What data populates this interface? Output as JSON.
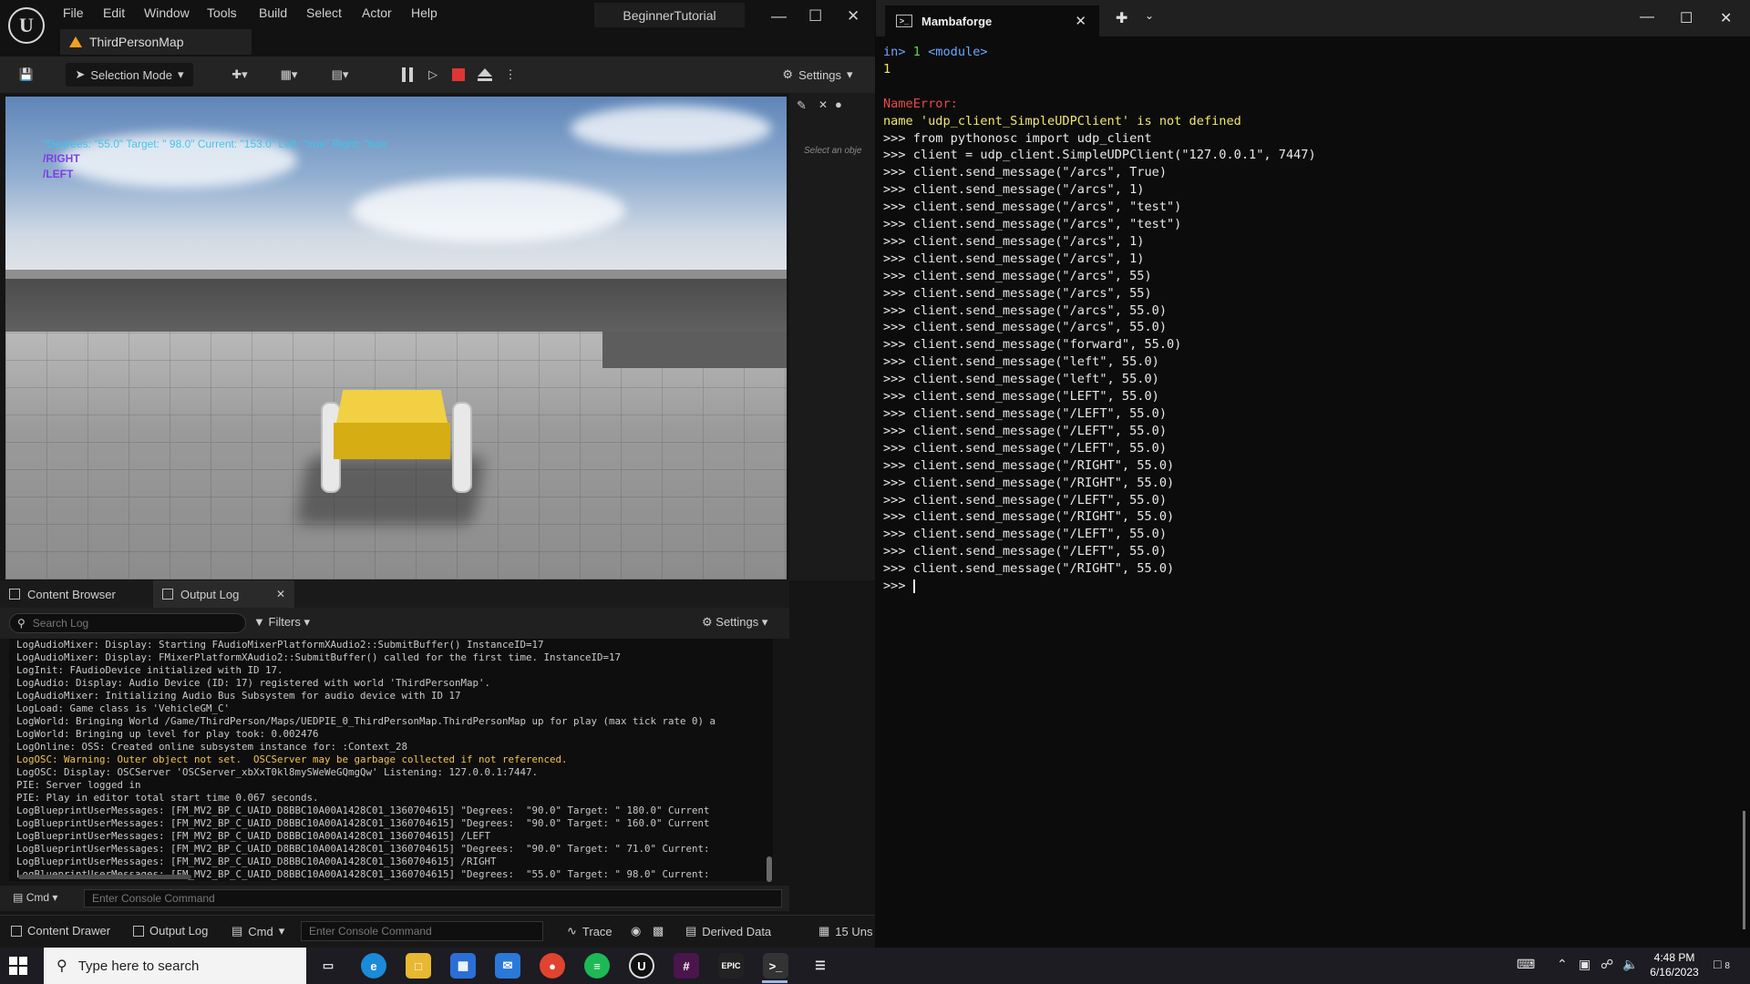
{
  "ue": {
    "menu": [
      "File",
      "Edit",
      "Window",
      "Tools",
      "Build",
      "Select",
      "Actor",
      "Help"
    ],
    "project_name": "BeginnerTutorial",
    "map_tab": "ThirdPersonMap",
    "toolbar": {
      "selection_mode": "Selection Mode",
      "settings": "Settings"
    },
    "viewport": {
      "debug_line": "\"Degrees: \"55.0\" Target: \" 98.0\" Current: \"153.0\" Left: \"true\" Right: \"true",
      "debug_right": "/RIGHT",
      "debug_left": "/LEFT"
    },
    "details": {
      "hint": "Select an obje"
    },
    "bottom_tabs": {
      "content_browser": "Content Browser",
      "output_log": "Output Log"
    },
    "log": {
      "search_placeholder": "Search Log",
      "filters": "Filters",
      "settings": "Settings",
      "lines": [
        {
          "text": "LogAudioMixer: Display: Starting FAudioMixerPlatformXAudio2::SubmitBuffer() InstanceID=17",
          "level": "normal"
        },
        {
          "text": "LogAudioMixer: Display: FMixerPlatformXAudio2::SubmitBuffer() called for the first time. InstanceID=17",
          "level": "normal"
        },
        {
          "text": "LogInit: FAudioDevice initialized with ID 17.",
          "level": "normal"
        },
        {
          "text": "LogAudio: Display: Audio Device (ID: 17) registered with world 'ThirdPersonMap'.",
          "level": "normal"
        },
        {
          "text": "LogAudioMixer: Initializing Audio Bus Subsystem for audio device with ID 17",
          "level": "normal"
        },
        {
          "text": "LogLoad: Game class is 'VehicleGM_C'",
          "level": "normal"
        },
        {
          "text": "LogWorld: Bringing World /Game/ThirdPerson/Maps/UEDPIE_0_ThirdPersonMap.ThirdPersonMap up for play (max tick rate 0) a",
          "level": "normal"
        },
        {
          "text": "LogWorld: Bringing up level for play took: 0.002476",
          "level": "normal"
        },
        {
          "text": "LogOnline: OSS: Created online subsystem instance for: :Context_28",
          "level": "normal"
        },
        {
          "text": "LogOSC: Warning: Outer object not set.  OSCServer may be garbage collected if not referenced.",
          "level": "warn"
        },
        {
          "text": "LogOSC: Display: OSCServer 'OSCServer_xbXxT0kl8mySWeWeGQmgQw' Listening: 127.0.0.1:7447.",
          "level": "normal"
        },
        {
          "text": "PIE: Server logged in",
          "level": "normal"
        },
        {
          "text": "PIE: Play in editor total start time 0.067 seconds.",
          "level": "normal"
        },
        {
          "text": "LogBlueprintUserMessages: [FM_MV2_BP_C_UAID_D8BBC10A00A1428C01_1360704615] \"Degrees:  \"90.0\" Target: \" 180.0\" Current",
          "level": "normal"
        },
        {
          "text": "LogBlueprintUserMessages: [FM_MV2_BP_C_UAID_D8BBC10A00A1428C01_1360704615] \"Degrees:  \"90.0\" Target: \" 160.0\" Current",
          "level": "normal"
        },
        {
          "text": "LogBlueprintUserMessages: [FM_MV2_BP_C_UAID_D8BBC10A00A1428C01_1360704615] /LEFT",
          "level": "normal"
        },
        {
          "text": "LogBlueprintUserMessages: [FM_MV2_BP_C_UAID_D8BBC10A00A1428C01_1360704615] \"Degrees:  \"90.0\" Target: \" 71.0\" Current:",
          "level": "normal"
        },
        {
          "text": "LogBlueprintUserMessages: [FM_MV2_BP_C_UAID_D8BBC10A00A1428C01_1360704615] /RIGHT",
          "level": "normal"
        },
        {
          "text": "LogBlueprintUserMessages: [FM_MV2_BP_C_UAID_D8BBC10A00A1428C01_1360704615] \"Degrees:  \"55.0\" Target: \" 98.0\" Current:",
          "level": "normal"
        }
      ],
      "cmd_label": "Cmd",
      "cmd_placeholder": "Enter Console Command"
    },
    "status": {
      "content_drawer": "Content Drawer",
      "output_log": "Output Log",
      "cmd": "Cmd",
      "cmd_placeholder": "Enter Console Command",
      "trace": "Trace",
      "derived_data": "Derived Data",
      "unsaved": "15 Uns"
    }
  },
  "terminal": {
    "tab_title": "Mambaforge",
    "lines": [
      {
        "segments": [
          {
            "t": "in> ",
            "c": "t-blue"
          },
          {
            "t": "1 ",
            "c": "t-green"
          },
          {
            "t": "<module>",
            "c": "t-blue"
          }
        ]
      },
      {
        "segments": [
          {
            "t": "1",
            "c": "t-yel"
          }
        ]
      },
      {
        "segments": []
      },
      {
        "segments": [
          {
            "t": "NameError:",
            "c": "t-err"
          }
        ]
      },
      {
        "segments": [
          {
            "t": "name 'udp_client_SimpleUDPClient' is not defined",
            "c": "t-yel"
          }
        ]
      },
      {
        "segments": [
          {
            "t": ">>> from pythonosc import udp_client",
            "c": ""
          }
        ]
      },
      {
        "segments": [
          {
            "t": ">>> client = udp_client.SimpleUDPClient(\"127.0.0.1\", 7447)",
            "c": ""
          }
        ]
      },
      {
        "segments": [
          {
            "t": ">>> client.send_message(\"/arcs\", True)",
            "c": ""
          }
        ]
      },
      {
        "segments": [
          {
            "t": ">>> client.send_message(\"/arcs\", 1)",
            "c": ""
          }
        ]
      },
      {
        "segments": [
          {
            "t": ">>> client.send_message(\"/arcs\", \"test\")",
            "c": ""
          }
        ]
      },
      {
        "segments": [
          {
            "t": ">>> client.send_message(\"/arcs\", \"test\")",
            "c": ""
          }
        ]
      },
      {
        "segments": [
          {
            "t": ">>> client.send_message(\"/arcs\", 1)",
            "c": ""
          }
        ]
      },
      {
        "segments": [
          {
            "t": ">>> client.send_message(\"/arcs\", 1)",
            "c": ""
          }
        ]
      },
      {
        "segments": [
          {
            "t": ">>> client.send_message(\"/arcs\", 55)",
            "c": ""
          }
        ]
      },
      {
        "segments": [
          {
            "t": ">>> client.send_message(\"/arcs\", 55)",
            "c": ""
          }
        ]
      },
      {
        "segments": [
          {
            "t": ">>> client.send_message(\"/arcs\", 55.0)",
            "c": ""
          }
        ]
      },
      {
        "segments": [
          {
            "t": ">>> client.send_message(\"/arcs\", 55.0)",
            "c": ""
          }
        ]
      },
      {
        "segments": [
          {
            "t": ">>> client.send_message(\"forward\", 55.0)",
            "c": ""
          }
        ]
      },
      {
        "segments": [
          {
            "t": ">>> client.send_message(\"left\", 55.0)",
            "c": ""
          }
        ]
      },
      {
        "segments": [
          {
            "t": ">>> client.send_message(\"left\", 55.0)",
            "c": ""
          }
        ]
      },
      {
        "segments": [
          {
            "t": ">>> client.send_message(\"LEFT\", 55.0)",
            "c": ""
          }
        ]
      },
      {
        "segments": [
          {
            "t": ">>> client.send_message(\"/LEFT\", 55.0)",
            "c": ""
          }
        ]
      },
      {
        "segments": [
          {
            "t": ">>> client.send_message(\"/LEFT\", 55.0)",
            "c": ""
          }
        ]
      },
      {
        "segments": [
          {
            "t": ">>> client.send_message(\"/LEFT\", 55.0)",
            "c": ""
          }
        ]
      },
      {
        "segments": [
          {
            "t": ">>> client.send_message(\"/RIGHT\", 55.0)",
            "c": ""
          }
        ]
      },
      {
        "segments": [
          {
            "t": ">>> client.send_message(\"/RIGHT\", 55.0)",
            "c": ""
          }
        ]
      },
      {
        "segments": [
          {
            "t": ">>> client.send_message(\"/LEFT\", 55.0)",
            "c": ""
          }
        ]
      },
      {
        "segments": [
          {
            "t": ">>> client.send_message(\"/RIGHT\", 55.0)",
            "c": ""
          }
        ]
      },
      {
        "segments": [
          {
            "t": ">>> client.send_message(\"/LEFT\", 55.0)",
            "c": ""
          }
        ]
      },
      {
        "segments": [
          {
            "t": ">>> client.send_message(\"/LEFT\", 55.0)",
            "c": ""
          }
        ]
      },
      {
        "segments": [
          {
            "t": ">>> client.send_message(\"/RIGHT\", 55.0)",
            "c": ""
          }
        ]
      },
      {
        "segments": [
          {
            "t": ">>> ",
            "c": ""
          }
        ],
        "cursor": true
      }
    ]
  },
  "taskbar": {
    "search_placeholder": "Type here to search",
    "time": "4:48 PM",
    "date": "6/16/2023",
    "notification_count": "8"
  },
  "colors": {
    "ue_accent": "#f0a020",
    "stop_red": "#e03535",
    "debug_cyan": "#41c4e8",
    "debug_purple": "#7e3fe0",
    "log_warning": "#f2c44f",
    "terminal_error": "#e84a4a",
    "terminal_yellow": "#f1e76b"
  }
}
